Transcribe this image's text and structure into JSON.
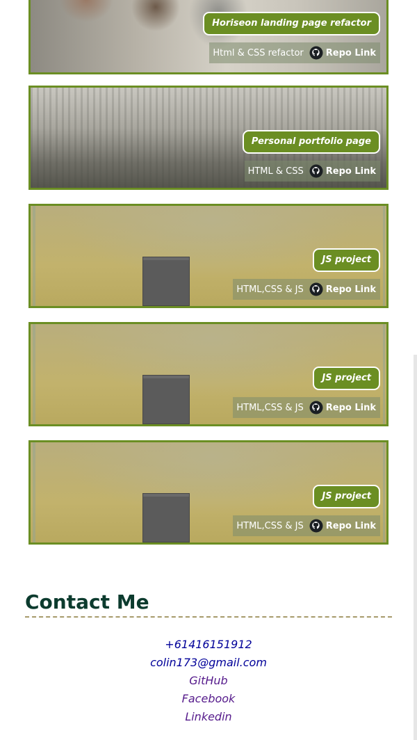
{
  "projects": [
    {
      "title": "Horiseon landing page refactor",
      "tech": "Html & CSS refactor",
      "repo_label": "Repo Link",
      "icon": "github-icon"
    },
    {
      "title": "Personal portfolio page",
      "tech": "HTML & CSS",
      "repo_label": "Repo Link",
      "icon": "github-icon"
    },
    {
      "title": "JS project",
      "tech": "HTML,CSS & JS",
      "repo_label": "Repo Link",
      "icon": "github-icon"
    },
    {
      "title": "JS project",
      "tech": "HTML,CSS & JS",
      "repo_label": "Repo Link",
      "icon": "github-icon"
    },
    {
      "title": "JS project",
      "tech": "HTML,CSS & JS",
      "repo_label": "Repo Link",
      "icon": "github-icon"
    }
  ],
  "contact": {
    "heading": "Contact Me",
    "phone": "+61416151912",
    "email": "colin173@gmail.com",
    "github": "GitHub",
    "facebook": "Facebook",
    "linkedin": "Linkedin"
  },
  "colors": {
    "accent": "#6b8e23",
    "heading": "#0c3b2e",
    "link": "#000099",
    "visited_link": "#551a8b"
  }
}
